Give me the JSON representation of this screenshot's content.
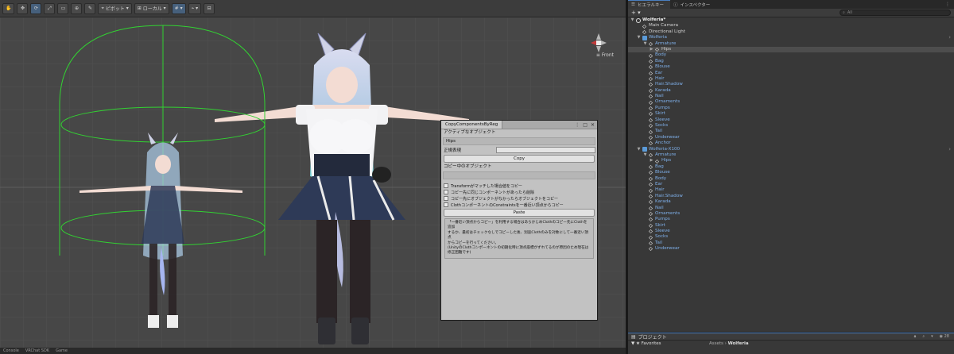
{
  "scene": {
    "toolbar": {
      "pivot": "ピボット",
      "local": "ローカル",
      "persp": "Front"
    },
    "bottom_tabs": [
      "Console",
      "VRChat SDK",
      "Game"
    ]
  },
  "ccr_window": {
    "title": "CopyComponentsByReg",
    "active_object_label": "アクティブなオブジェクト",
    "active_object": "Hips",
    "regex_label": "正規表現",
    "copy_button": "Copy",
    "copying_label": "コピー中のオブジェクト",
    "options": [
      {
        "label": "Transformがマッチした場合値をコピー",
        "checked": false
      },
      {
        "label": "コピー先に同じコンポーネントがあったら削除",
        "checked": false
      },
      {
        "label": "コピー先にオブジェクトがなかったらオブジェクトをコピー",
        "checked": false
      },
      {
        "label": "ClothコンポーネントのConstraintsを一番近い頂点からコピー",
        "checked": false
      }
    ],
    "paste_button": "Paste",
    "help_lines": [
      "「一番近い頂点からコピー」を利用する場合はあらかじめClothのコピー先にClothを追加",
      "するか、最初はチェックなしでコピーした後、別途Clothのみを対象にして一番近い頂点",
      "からコピーを行ってください。",
      "(UnityのClothコンポーネントの初期化時に頂点座標がずれてるのが原因のため現在は",
      "修正困難です)"
    ]
  },
  "hierarchy": {
    "tab_label": "ヒエラルキー",
    "inspector_tab": "インスペクター",
    "search_placeholder": "All",
    "add_label": "+ ▾",
    "rows": [
      {
        "label": "Wolferia*",
        "depth": 0,
        "arrow": "▼",
        "icon": "scene",
        "style": "scene"
      },
      {
        "label": "Main Camera",
        "depth": 1,
        "arrow": "",
        "icon": "cube",
        "style": ""
      },
      {
        "label": "Directional Light",
        "depth": 1,
        "arrow": "",
        "icon": "cube",
        "style": ""
      },
      {
        "label": "Wolferia",
        "depth": 1,
        "arrow": "▼",
        "icon": "prefab",
        "style": "blue",
        "chevron": true
      },
      {
        "label": "Armature",
        "depth": 2,
        "arrow": "▼",
        "icon": "cube",
        "style": "blue"
      },
      {
        "label": "Hips",
        "depth": 3,
        "arrow": "▶",
        "icon": "cube",
        "style": "",
        "selected": true
      },
      {
        "label": "Body",
        "depth": 2,
        "arrow": "",
        "icon": "cube",
        "style": "blue"
      },
      {
        "label": "Bag",
        "depth": 2,
        "arrow": "",
        "icon": "cube",
        "style": "blue"
      },
      {
        "label": "Blouse",
        "depth": 2,
        "arrow": "",
        "icon": "cube",
        "style": "blue"
      },
      {
        "label": "Ear",
        "depth": 2,
        "arrow": "",
        "icon": "cube",
        "style": "blue"
      },
      {
        "label": "Hair",
        "depth": 2,
        "arrow": "",
        "icon": "cube",
        "style": "blue"
      },
      {
        "label": "Hair.Shadow",
        "depth": 2,
        "arrow": "",
        "icon": "cube",
        "style": "blue"
      },
      {
        "label": "Karada",
        "depth": 2,
        "arrow": "",
        "icon": "cube",
        "style": "blue"
      },
      {
        "label": "Nail",
        "depth": 2,
        "arrow": "",
        "icon": "cube",
        "style": "blue"
      },
      {
        "label": "Ornaments",
        "depth": 2,
        "arrow": "",
        "icon": "cube",
        "style": "blue"
      },
      {
        "label": "Pumps",
        "depth": 2,
        "arrow": "",
        "icon": "cube",
        "style": "blue"
      },
      {
        "label": "Skirt",
        "depth": 2,
        "arrow": "",
        "icon": "cube",
        "style": "blue"
      },
      {
        "label": "Sleeve",
        "depth": 2,
        "arrow": "",
        "icon": "cube",
        "style": "blue"
      },
      {
        "label": "Socks",
        "depth": 2,
        "arrow": "",
        "icon": "cube",
        "style": "blue"
      },
      {
        "label": "Tail",
        "depth": 2,
        "arrow": "",
        "icon": "cube",
        "style": "blue"
      },
      {
        "label": "Underwear",
        "depth": 2,
        "arrow": "",
        "icon": "cube",
        "style": "blue"
      },
      {
        "label": "Anchor",
        "depth": 2,
        "arrow": "",
        "icon": "cube",
        "style": "blue"
      },
      {
        "label": "Wolferia-X100",
        "depth": 1,
        "arrow": "▼",
        "icon": "prefab",
        "style": "blue",
        "chevron": true
      },
      {
        "label": "Armature",
        "depth": 2,
        "arrow": "▼",
        "icon": "cube",
        "style": "blue"
      },
      {
        "label": "Hips",
        "depth": 3,
        "arrow": "▶",
        "icon": "cube",
        "style": "blue"
      },
      {
        "label": "Bag",
        "depth": 2,
        "arrow": "",
        "icon": "cube",
        "style": "blue"
      },
      {
        "label": "Blouse",
        "depth": 2,
        "arrow": "",
        "icon": "cube",
        "style": "blue"
      },
      {
        "label": "Body",
        "depth": 2,
        "arrow": "",
        "icon": "cube",
        "style": "blue"
      },
      {
        "label": "Ear",
        "depth": 2,
        "arrow": "",
        "icon": "cube",
        "style": "blue"
      },
      {
        "label": "Hair",
        "depth": 2,
        "arrow": "",
        "icon": "cube",
        "style": "blue"
      },
      {
        "label": "Hair.Shadow",
        "depth": 2,
        "arrow": "",
        "icon": "cube",
        "style": "blue"
      },
      {
        "label": "Karada",
        "depth": 2,
        "arrow": "",
        "icon": "cube",
        "style": "blue"
      },
      {
        "label": "Nail",
        "depth": 2,
        "arrow": "",
        "icon": "cube",
        "style": "blue"
      },
      {
        "label": "Ornaments",
        "depth": 2,
        "arrow": "",
        "icon": "cube",
        "style": "blue"
      },
      {
        "label": "Pumps",
        "depth": 2,
        "arrow": "",
        "icon": "cube",
        "style": "blue"
      },
      {
        "label": "Skirt",
        "depth": 2,
        "arrow": "",
        "icon": "cube",
        "style": "blue"
      },
      {
        "label": "Sleeve",
        "depth": 2,
        "arrow": "",
        "icon": "cube",
        "style": "blue"
      },
      {
        "label": "Socks",
        "depth": 2,
        "arrow": "",
        "icon": "cube",
        "style": "blue"
      },
      {
        "label": "Tail",
        "depth": 2,
        "arrow": "",
        "icon": "cube",
        "style": "blue"
      },
      {
        "label": "Underwear",
        "depth": 2,
        "arrow": "",
        "icon": "cube",
        "style": "blue"
      }
    ]
  },
  "project": {
    "tab_label": "プロジェクト",
    "favorites": "Favorites",
    "breadcrumb_root": "Assets",
    "breadcrumb_current": "Wolferia",
    "count_label": "28"
  },
  "colors": {
    "accent": "#4a7fc1",
    "prefab_blue": "#7fb0ea",
    "collider_green": "#32d232"
  }
}
